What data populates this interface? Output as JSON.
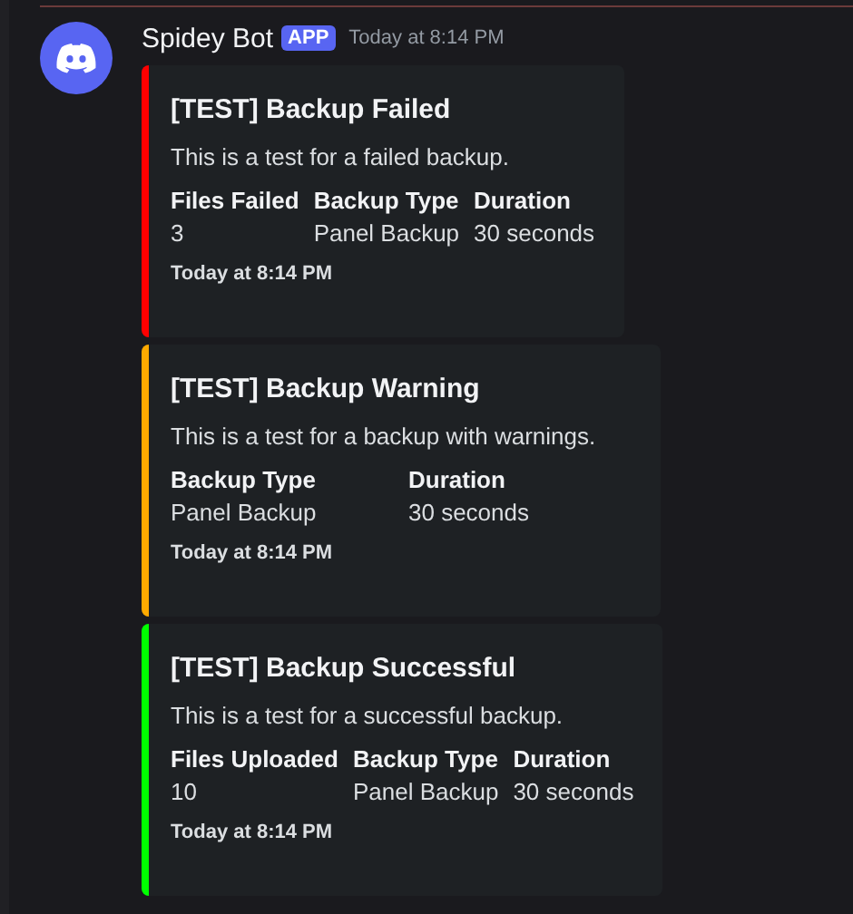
{
  "message": {
    "author": "Spidey Bot",
    "badge": "APP",
    "timestamp": "Today at 8:14 PM"
  },
  "embeds": [
    {
      "color": "#ff0000",
      "title": "[TEST] Backup Failed",
      "description": "This is a test for a failed backup.",
      "fields": [
        {
          "name": "Files Failed",
          "value": "3"
        },
        {
          "name": "Backup Type",
          "value": "Panel Backup"
        },
        {
          "name": "Duration",
          "value": "30 seconds"
        }
      ],
      "footer": "Today at 8:14 PM"
    },
    {
      "color": "#ffaa00",
      "title": "[TEST] Backup Warning",
      "description": "This is a test for a backup with warnings.",
      "fields": [
        {
          "name": "Backup Type",
          "value": "Panel Backup"
        },
        {
          "name": "Duration",
          "value": "30 seconds"
        }
      ],
      "footer": "Today at 8:14 PM"
    },
    {
      "color": "#00ff00",
      "title": "[TEST] Backup Successful",
      "description": "This is a test for a successful backup.",
      "fields": [
        {
          "name": "Files Uploaded",
          "value": "10"
        },
        {
          "name": "Backup Type",
          "value": "Panel Backup"
        },
        {
          "name": "Duration",
          "value": "30 seconds"
        }
      ],
      "footer": "Today at 8:14 PM"
    }
  ]
}
